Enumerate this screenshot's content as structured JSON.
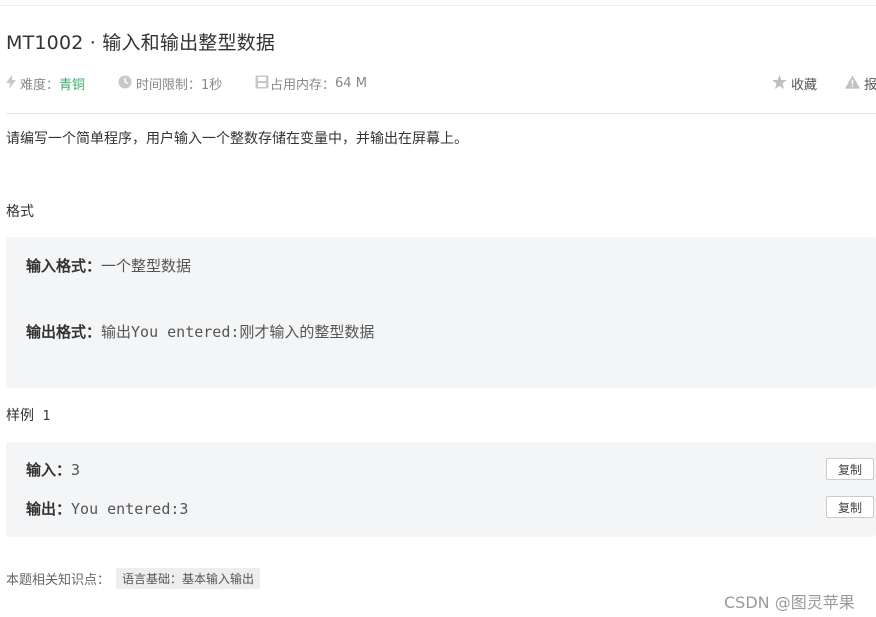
{
  "problem": {
    "title": "MT1002 · 输入和输出整型数据"
  },
  "meta": {
    "difficulty_label": "难度：",
    "difficulty_value": "青铜",
    "time_label": "时间限制：",
    "time_value": "1秒",
    "memory_label": "占用内存：",
    "memory_value": "64 M",
    "favorite_label": "收藏",
    "report_label": "报"
  },
  "description": "请编写一个简单程序，用户输入一个整数存储在变量中，并输出在屏幕上。",
  "format": {
    "heading": "格式",
    "input_label": "输入格式：",
    "input_text": "一个整型数据",
    "output_label": "输出格式：",
    "output_text": "输出You entered:刚才输入的整型数据"
  },
  "sample": {
    "heading": "样例",
    "number": "1",
    "input_label": "输入：",
    "input_value": "3",
    "output_label": "输出：",
    "output_value": "You entered:3",
    "copy_label": "复制"
  },
  "knowledge": {
    "label": "本题相关知识点：",
    "tag": "语言基础：基本输入输出"
  },
  "watermark": "CSDN @图灵苹果",
  "icons": [
    "bolt-icon",
    "clock-icon",
    "memory-icon",
    "star-icon",
    "warning-icon"
  ]
}
